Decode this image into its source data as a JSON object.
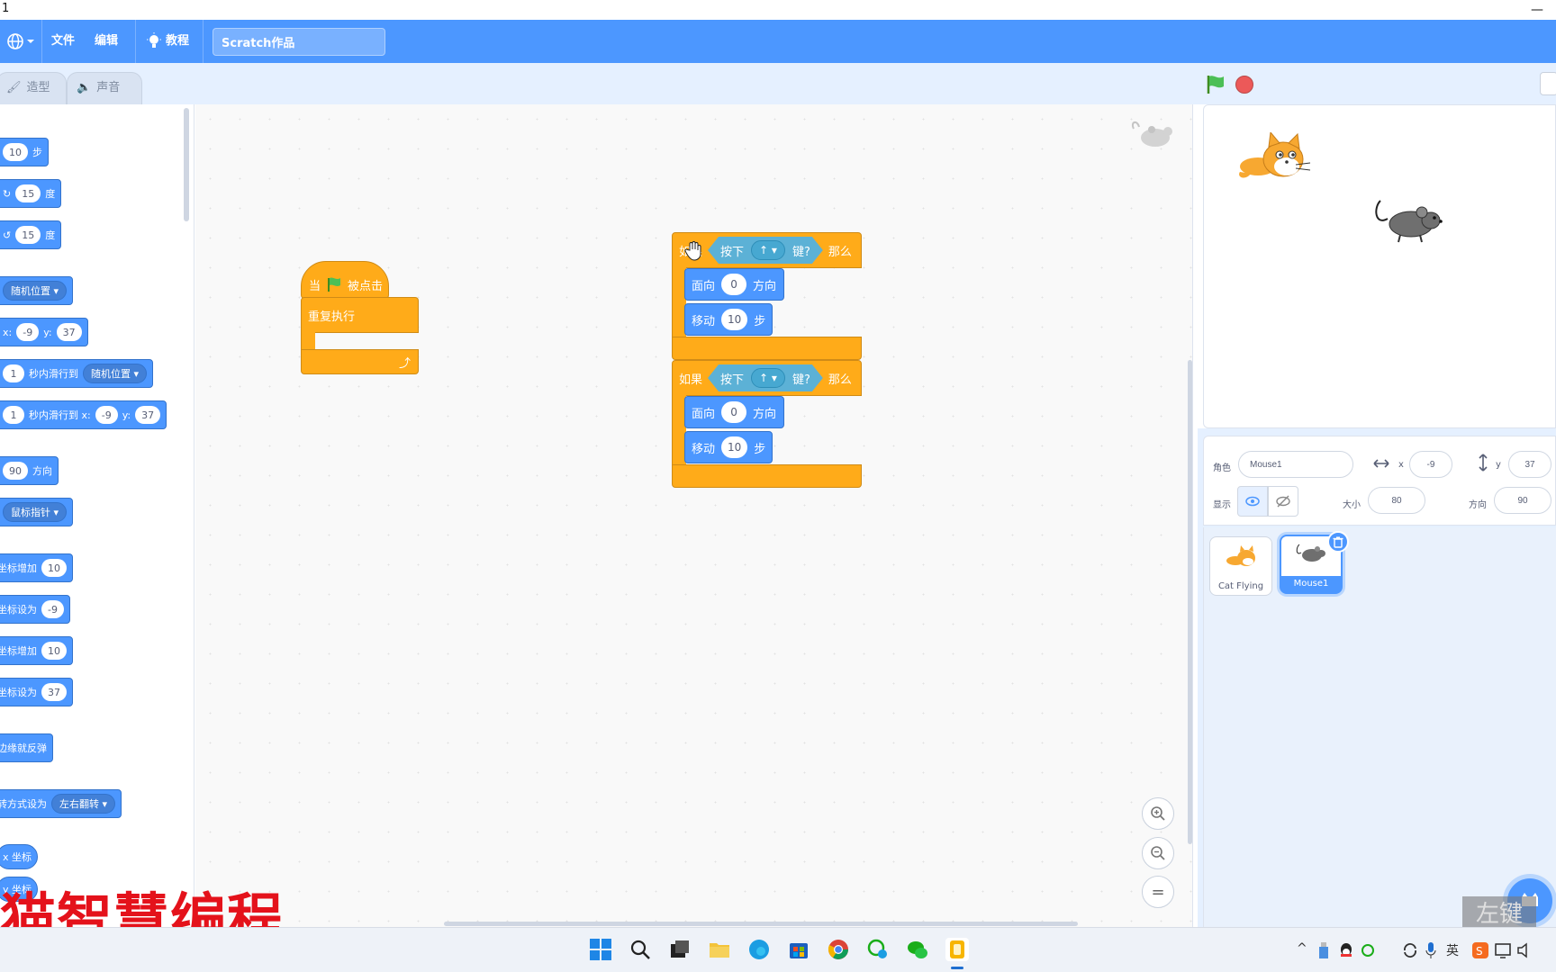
{
  "window": {
    "title": "1",
    "minimize_glyph": "—"
  },
  "menubar": {
    "language_icon": "globe-icon",
    "file": "文件",
    "edit": "编辑",
    "tutorials": "教程",
    "project_title": "Scratch作品"
  },
  "tabs": {
    "costumes": "造型",
    "sounds": "声音"
  },
  "palette": {
    "move_steps": "10",
    "move_unit": "步",
    "turn_right": "15",
    "turn_left": "15",
    "degree_unit": "度",
    "goto_dd": "随机位置",
    "goto_x_label": "x:",
    "goto_x": "-9",
    "goto_y_label": "y:",
    "goto_y": "37",
    "glide_secs": "1",
    "glide_label": "秒内滑行到",
    "glide_dd": "随机位置",
    "glide2_secs": "1",
    "glide2_label": "秒内滑行到 x:",
    "glide2_x": "-9",
    "glide2_y_label": "y:",
    "glide2_y": "37",
    "point_dir": "90",
    "point_unit": "方向",
    "point_towards_dd": "鼠标指针",
    "change_x_label": "坐标增加",
    "change_x": "10",
    "set_x_label": "坐标设为",
    "set_x": "-9",
    "change_y_label": "坐标增加",
    "change_y": "10",
    "set_y_label": "坐标设为",
    "set_y": "37",
    "bounce": "边缘就反弹",
    "rot_label": "转方式设为",
    "rot_dd": "左右翻转",
    "x_reporter": "x 坐标",
    "y_reporter": "y 坐标"
  },
  "script1": {
    "hat_when": "当",
    "hat_clicked": "被点击",
    "forever": "重复执行"
  },
  "script2": {
    "if1_label": "如果",
    "if1_key_pressed": "按下",
    "if1_key": "↑",
    "if1_key_suffix": "键?",
    "if1_then": "那么",
    "if1_point_label": "面向",
    "if1_point_value": "0",
    "if1_point_suffix": "方向",
    "if1_move_label": "移动",
    "if1_move_value": "10",
    "if1_move_suffix": "步",
    "if2_label": "如果",
    "if2_key_pressed": "按下",
    "if2_key": "↑",
    "if2_key_suffix": "键?",
    "if2_then": "那么",
    "if2_point_label": "面向",
    "if2_point_value": "0",
    "if2_point_suffix": "方向",
    "if2_move_label": "移动",
    "if2_move_value": "10",
    "if2_move_suffix": "步"
  },
  "zoom": {
    "zoom_in_icon": "zoom-in-icon",
    "zoom_out_icon": "zoom-out-icon",
    "reset_glyph": "="
  },
  "sprite_info": {
    "sprite_label": "角色",
    "sprite_name": "Mouse1",
    "x_label": "x",
    "x_value": "-9",
    "y_label": "y",
    "y_value": "37",
    "show_label": "显示",
    "size_label": "大小",
    "size_value": "80",
    "direction_label": "方向",
    "direction_value": "90"
  },
  "sprites": [
    {
      "name": "Cat Flying",
      "selected": false
    },
    {
      "name": "Mouse1",
      "selected": true
    }
  ],
  "overlay_label": "左键",
  "watermark": "猫智慧编程",
  "colors": {
    "menu_blue": "#4c97ff",
    "motion": "#4c97ff",
    "control": "#ffab19",
    "events": "#ffbf00",
    "sensing": "#5cb1d6",
    "stop_red": "#ec5959",
    "watermark_red": "#e4121b"
  }
}
